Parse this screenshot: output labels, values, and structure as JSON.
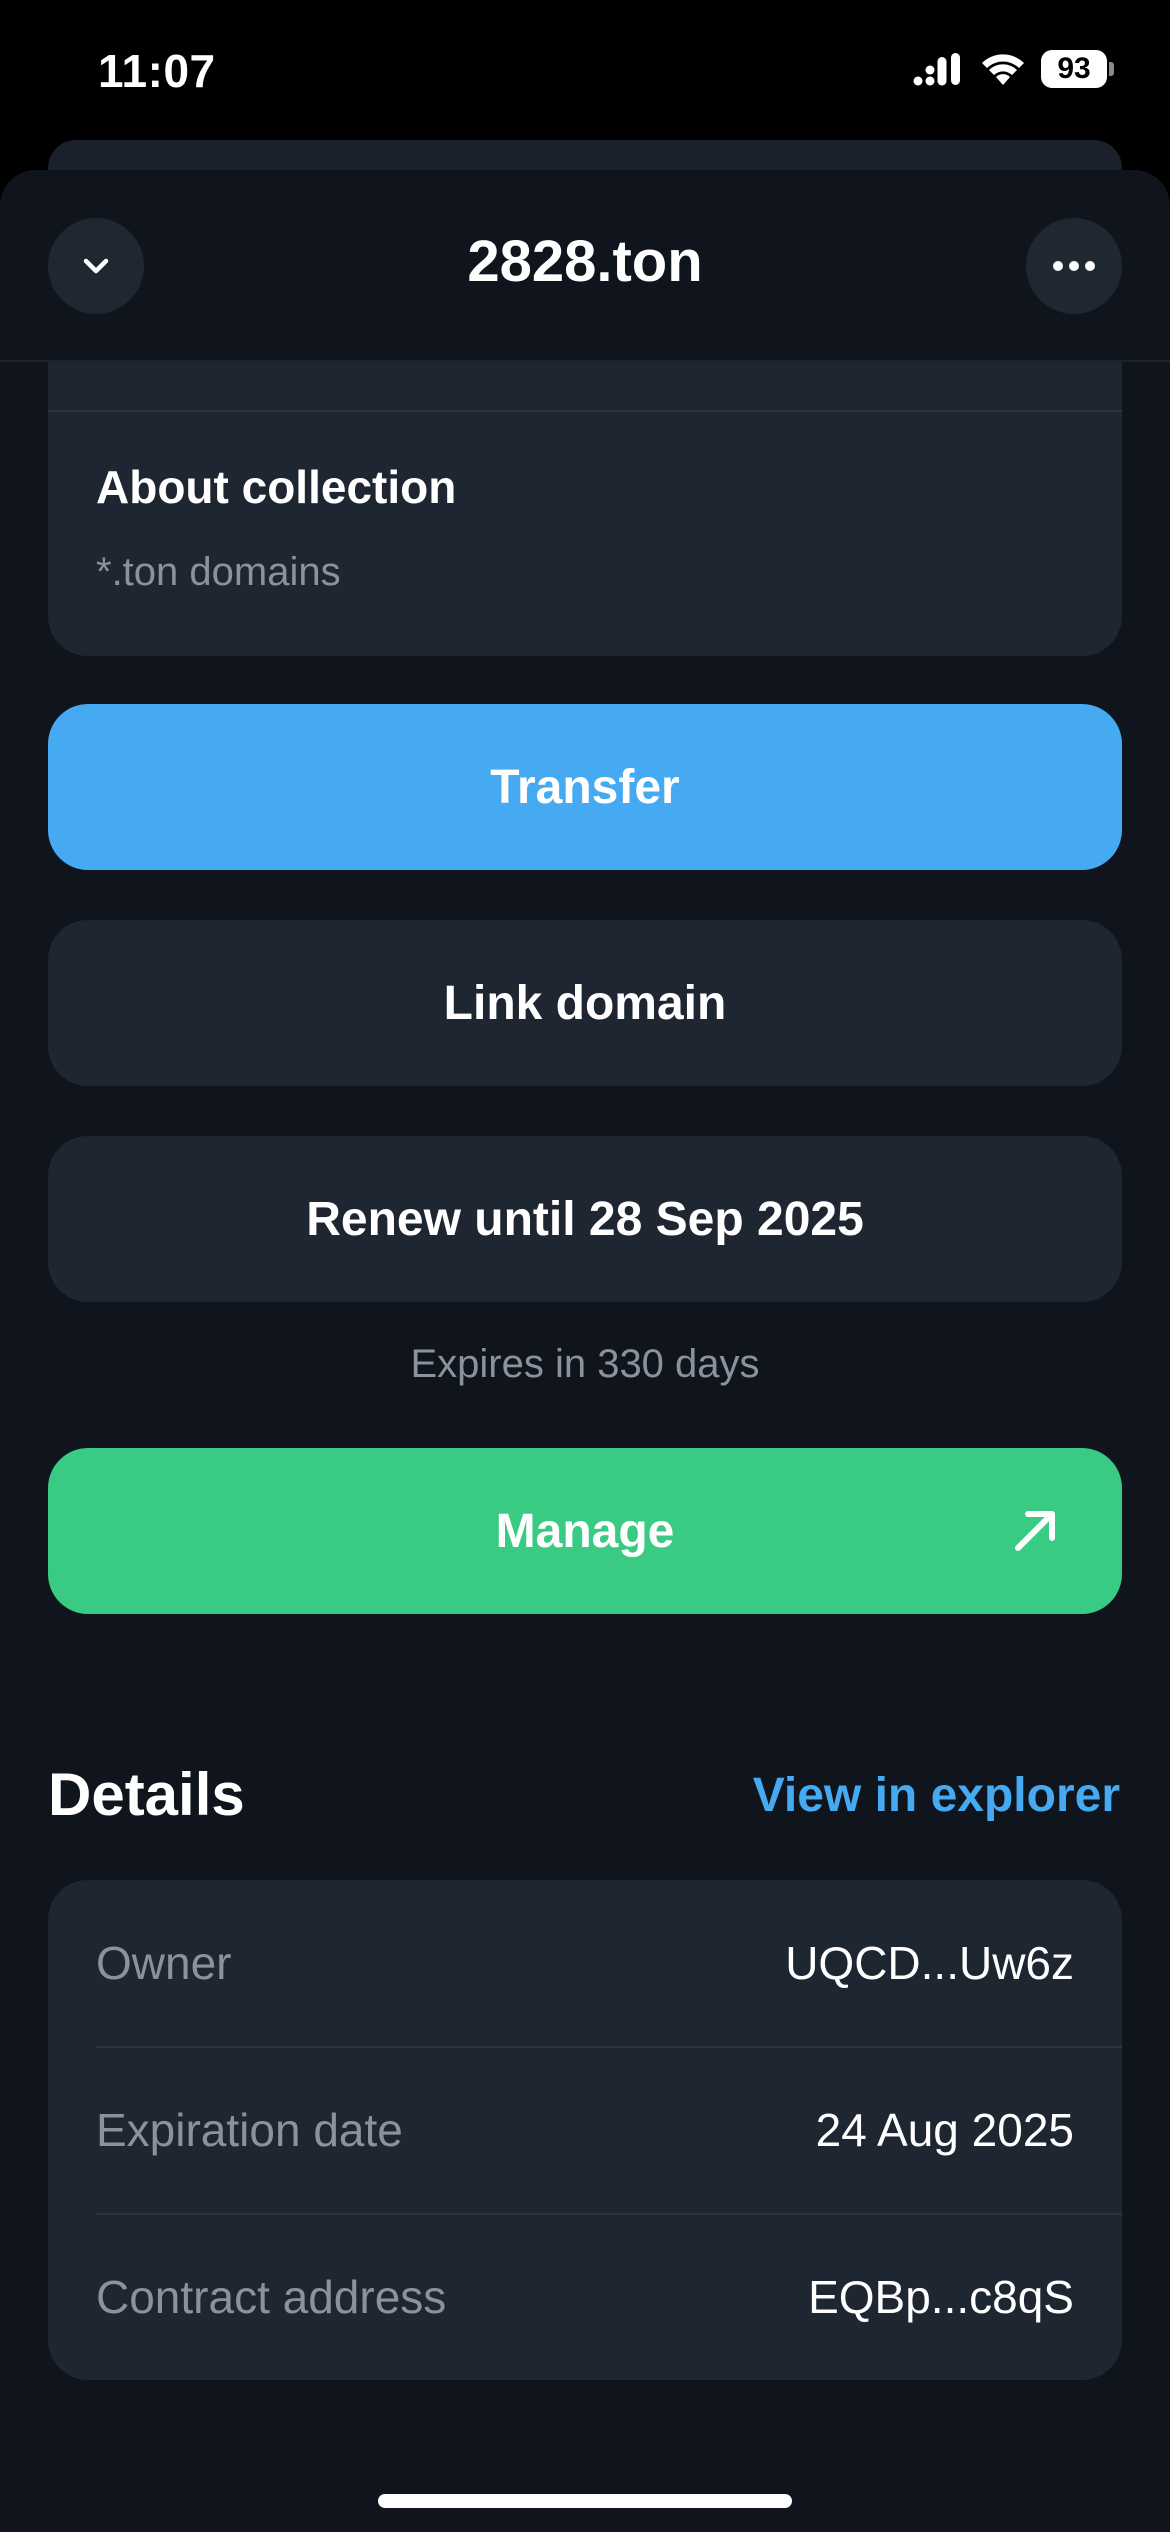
{
  "status_bar": {
    "time": "11:07",
    "battery": "93",
    "icons": [
      "signal-icon",
      "wifi-icon",
      "battery-icon"
    ]
  },
  "header": {
    "title": "2828.ton",
    "left_icon": "chevron-down-icon",
    "right_icon": "more-dots-icon"
  },
  "about": {
    "title": "About collection",
    "subtitle": "*.ton domains"
  },
  "actions": {
    "transfer_label": "Transfer",
    "link_label": "Link domain",
    "renew_label": "Renew until 28 Sep 2025",
    "expires_text": "Expires in 330 days",
    "manage_label": "Manage",
    "manage_icon": "arrow-up-right-icon"
  },
  "details": {
    "title": "Details",
    "explorer_link": "View in explorer",
    "rows": [
      {
        "label": "Owner",
        "value": "UQCD...Uw6z"
      },
      {
        "label": "Expiration date",
        "value": "24 Aug 2025"
      },
      {
        "label": "Contract address",
        "value": "EQBp...c8qS"
      }
    ]
  },
  "colors": {
    "background": "#10151d",
    "card": "#1e2631",
    "transfer": "#45aaf2",
    "manage": "#39cb84",
    "link": "#45aaf2",
    "muted_text": "#8b929c"
  }
}
